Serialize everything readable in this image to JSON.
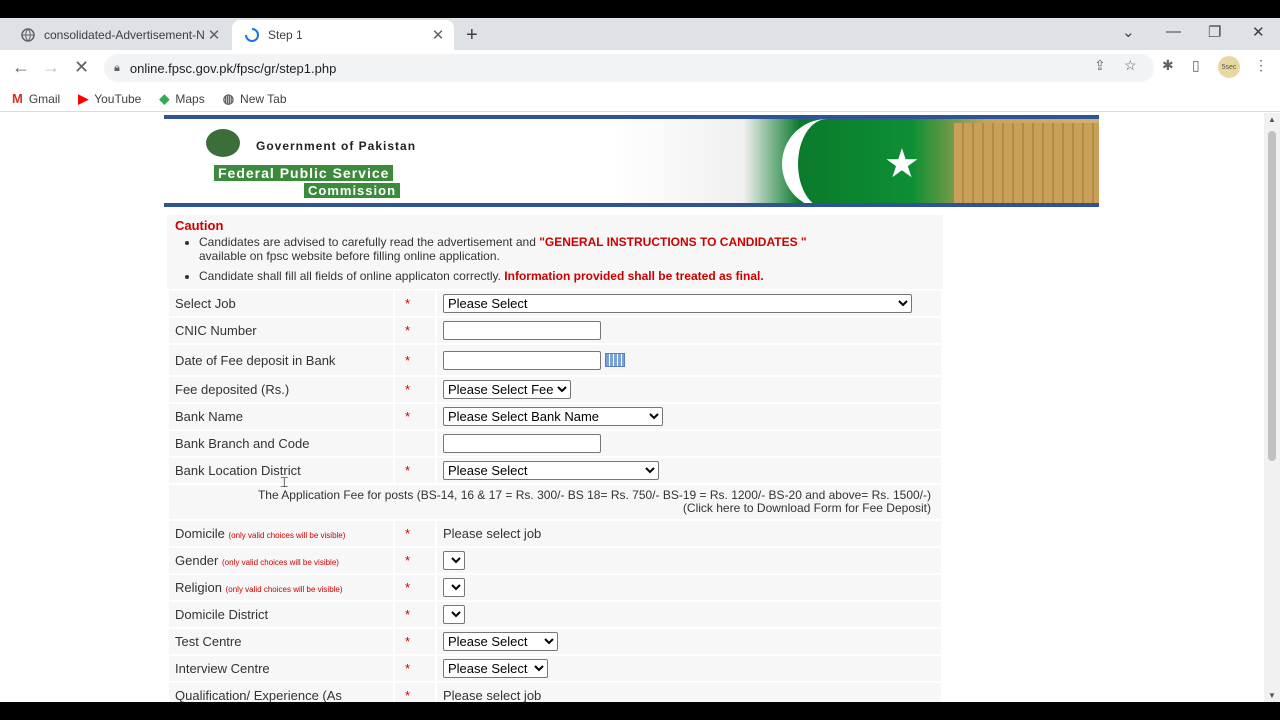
{
  "browser": {
    "tabs": [
      {
        "title": "consolidated-Advertisement-No",
        "active": false
      },
      {
        "title": "Step 1",
        "active": true
      }
    ],
    "url": "online.fpsc.gov.pk/fpsc/gr/step1.php",
    "bookmarks": [
      "Gmail",
      "YouTube",
      "Maps",
      "New Tab"
    ],
    "avatar": "5sec"
  },
  "banner": {
    "gov": "Government of Pakistan",
    "fpsc_line1": "Federal Public Service",
    "fpsc_line2": "Commission"
  },
  "caution": {
    "heading": "Caution",
    "item1_pre": "Candidates are advised to carefully read the advertisement and ",
    "item1_red": "\"GENERAL INSTRUCTIONS TO CANDIDATES \"",
    "item1_post": "available on fpsc website before filling online application.",
    "item2_pre": "Candidate shall fill all fields of online applicaton correctly. ",
    "item2_red": "Information provided shall be treated as final."
  },
  "form": {
    "required_mark": "*",
    "small_note": "(only valid choices will be visible)",
    "select_job": {
      "label": "Select Job",
      "value": "Please Select"
    },
    "cnic": {
      "label": "CNIC Number"
    },
    "fee_date": {
      "label": "Date of Fee deposit in Bank"
    },
    "fee_amount": {
      "label": "Fee deposited (Rs.)",
      "value": "Please Select Fee"
    },
    "bank_name": {
      "label": "Bank Name",
      "value": "Please Select Bank Name"
    },
    "bank_branch": {
      "label": "Bank Branch and Code"
    },
    "bank_district": {
      "label": "Bank Location District",
      "value": "Please Select"
    },
    "fee_info": "The Application Fee for posts (BS-14, 16 & 17 = Rs. 300/- BS 18= Rs. 750/- BS-19 = Rs. 1200/- BS-20 and above= Rs. 1500/-)",
    "fee_link": "(Click here to Download Form for Fee Deposit)",
    "domicile": {
      "label": "Domicile",
      "value": "Please select job"
    },
    "gender": {
      "label": "Gender"
    },
    "religion": {
      "label": "Religion"
    },
    "domicile_district": {
      "label": "Domicile District"
    },
    "test_centre": {
      "label": "Test Centre",
      "value": "Please Select"
    },
    "interview_centre": {
      "label": "Interview Centre",
      "value": "Please Select"
    },
    "qualification": {
      "label": "Qualification/ Experience (As",
      "value": "Please select job"
    }
  }
}
